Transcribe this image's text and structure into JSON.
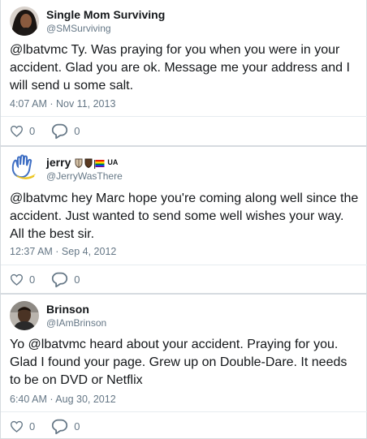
{
  "tweets": [
    {
      "display_name": "Single Mom Surviving",
      "handle": "@SMSurviving",
      "text": "@lbatvmc Ty. Was praying for you when you were in your accident. Glad you are ok. Message me your address and I will send u some salt.",
      "timestamp": "4:07 AM · Nov 11, 2013",
      "likes": "0",
      "replies": "0"
    },
    {
      "display_name": "jerry",
      "badge_text": "UA",
      "handle": "@JerryWasThere",
      "text": "@lbatvmc hey Marc hope you're coming along well since the accident. Just wanted to send some well wishes your way. All the best sir.",
      "timestamp": "12:37 AM · Sep 4, 2012",
      "likes": "0",
      "replies": "0"
    },
    {
      "display_name": "Brinson",
      "handle": "@IAmBrinson",
      "text": "Yo @lbatvmc heard about your accident. Praying for you. Glad I found your page. Grew up on Double-Dare. It needs to be on DVD or Netflix",
      "timestamp": "6:40 AM · Aug 30, 2012",
      "likes": "0",
      "replies": "0"
    }
  ],
  "icons": {
    "like": "heart-outline-icon",
    "reply": "speech-bubble-outline-icon"
  },
  "colors": {
    "text": "#14171a",
    "secondary": "#657786",
    "border": "#d6dbe0"
  }
}
